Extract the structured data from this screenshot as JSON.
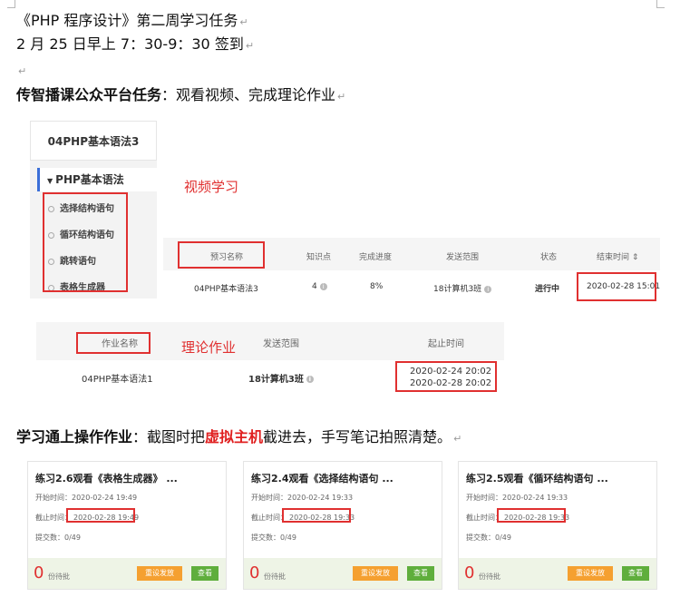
{
  "doc": {
    "title": "《PHP 程序设计》第二周学习任务",
    "checkin": "2 月 25 日早上 7：30-9：30 签到",
    "task1_bold": "传智播课公众平台任务",
    "task1_rest": "：观看视频、完成理论作业",
    "task2_bold": "学习通上操作作业",
    "task2_mid": "：截图时把",
    "task2_red": "虚拟主机",
    "task2_end": "截进去，手写笔记拍照清楚。",
    "para_mark": "↵"
  },
  "sidebar": {
    "course": "04PHP基本语法3",
    "section": "PHP基本语法",
    "items": [
      "选择结构语句",
      "循环结构语句",
      "跳转语句",
      "表格生成器"
    ]
  },
  "labels": {
    "video": "视频学习",
    "theory": "理论作业"
  },
  "table1": {
    "headers": [
      "预习名称",
      "知识点",
      "完成进度",
      "发送范围",
      "状态",
      "结束时间 ⇕"
    ],
    "row": [
      "04PHP基本语法3",
      "4",
      "8%",
      "18计算机3班",
      "进行中",
      "2020-02-28 15:01"
    ]
  },
  "table2": {
    "headers": [
      "作业名称",
      "发送范围",
      "起止时间"
    ],
    "row": {
      "name": "04PHP基本语法1",
      "scope": "18计算机3班",
      "start": "2020-02-24 20:02",
      "end": "2020-02-28 20:02"
    }
  },
  "cards": [
    {
      "title": "练习2.6观看《表格生成器》 ...",
      "start": "开始时间：2020-02-24 19:49",
      "end_label": "截止时间",
      "end": "2020-02-28 19:49",
      "submit": "提交数：0/49",
      "count": "0",
      "pending": "份待批",
      "reissue": "重设发放",
      "view": "查看"
    },
    {
      "title": "练习2.4观看《选择结构语句 ...",
      "start": "开始时间：2020-02-24 19:33",
      "end_label": "截止时间",
      "end": "2020-02-28 19:33",
      "submit": "提交数：0/49",
      "count": "0",
      "pending": "份待批",
      "reissue": "重设发放",
      "view": "查看"
    },
    {
      "title": "练习2.5观看《循环结构语句 ...",
      "start": "开始时间：2020-02-24 19:33",
      "end_label": "截止时间",
      "end": "2020-02-28 19:33",
      "submit": "提交数：0/49",
      "count": "0",
      "pending": "份待批",
      "reissue": "重设发放",
      "view": "查看"
    }
  ],
  "colors": {
    "highlight_red": "#e03030",
    "orange_button": "#f5a030",
    "green_button": "#5fae3c",
    "accent_blue": "#3b6fd8"
  }
}
